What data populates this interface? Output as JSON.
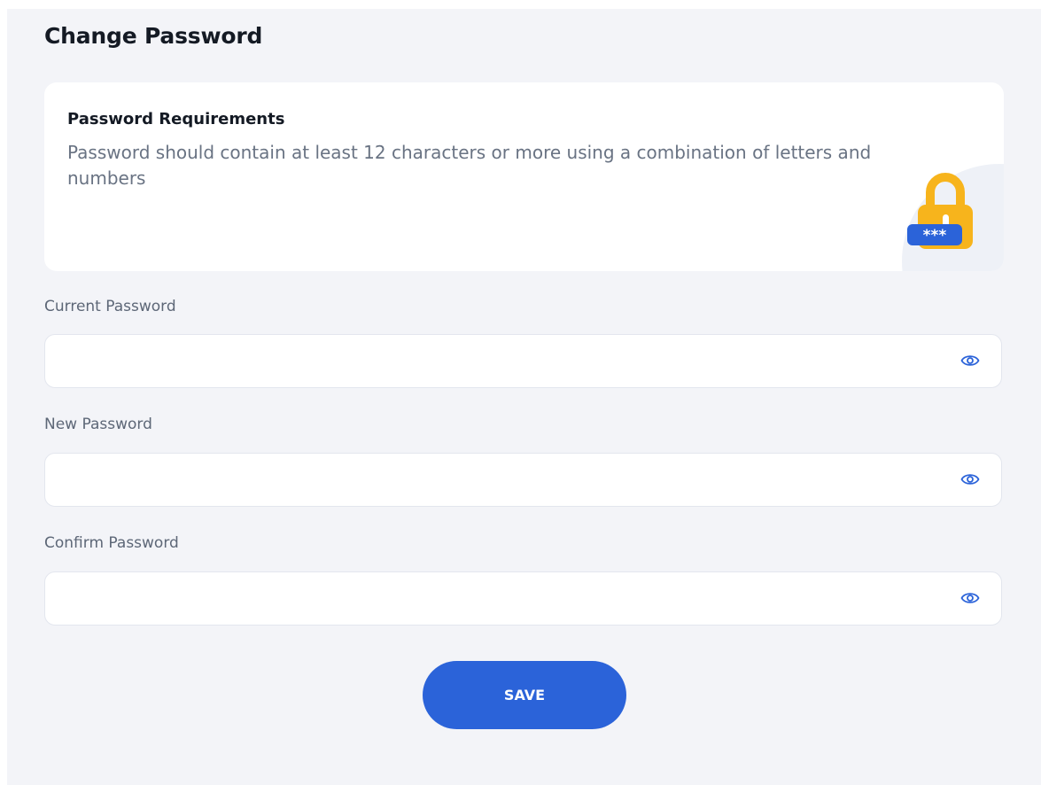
{
  "page": {
    "title": "Change Password"
  },
  "requirements": {
    "title": "Password Requirements",
    "text": "Password should contain at least 12 characters or more using a combination of letters and numbers",
    "illustration_label": "***"
  },
  "form": {
    "current_password": {
      "label": "Current Password",
      "value": "",
      "placeholder": ""
    },
    "new_password": {
      "label": "New Password",
      "value": "",
      "placeholder": ""
    },
    "confirm_password": {
      "label": "Confirm Password",
      "value": "",
      "placeholder": ""
    },
    "save_label": "SAVE"
  },
  "icons": {
    "reveal": "eye-icon",
    "illustration": "lock-icon"
  },
  "colors": {
    "accent": "#2b63d9",
    "lock": "#f7b41c",
    "panel_bg": "#f3f4f8"
  }
}
